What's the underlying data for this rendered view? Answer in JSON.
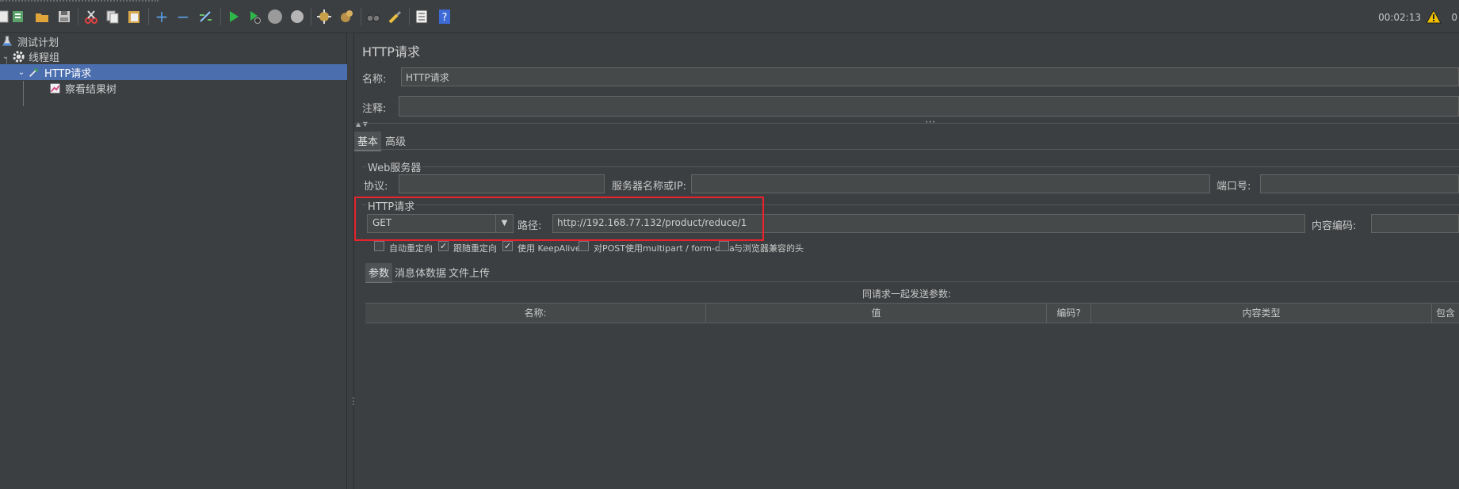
{
  "toolbar": {
    "icons": [
      "new-icon",
      "templates-icon",
      "open-icon",
      "save-icon",
      "cut-icon",
      "copy-icon",
      "paste-icon",
      "expand-icon",
      "collapse-icon",
      "toggle-icon",
      "start-icon",
      "start-no-pause-icon",
      "stop-icon",
      "shutdown-icon",
      "clear-icon",
      "clear-all-icon",
      "search-icon",
      "reset-search-icon",
      "function-helper-icon",
      "help-icon"
    ],
    "timer": "00:02:13",
    "warning_count": "0"
  },
  "tree": {
    "items": [
      {
        "label": "测试计划",
        "icon": "test-plan-icon"
      },
      {
        "label": "线程组",
        "icon": "thread-group-gear-icon"
      },
      {
        "label": "HTTP请求",
        "icon": "http-sampler-pipette-icon"
      },
      {
        "label": "察看结果树",
        "icon": "results-tree-chart-icon"
      }
    ]
  },
  "main": {
    "title": "HTTP请求",
    "name_label": "名称:",
    "name_value": "HTTP请求",
    "comment_label": "注释:",
    "comment_value": "",
    "tabs": [
      {
        "label": "基本"
      },
      {
        "label": "高级"
      }
    ],
    "web_server": {
      "title": "Web服务器",
      "protocol_label": "协议:",
      "protocol_value": "",
      "server_label": "服务器名称或IP:",
      "server_value": "",
      "port_label": "端口号:",
      "port_value": ""
    },
    "http_request": {
      "title": "HTTP请求",
      "method": "GET",
      "path_label": "路径:",
      "path_value": "http://192.168.77.132/product/reduce/1",
      "encoding_label": "内容编码:",
      "encoding_value": ""
    },
    "options": [
      {
        "label": "自动重定向",
        "checked": false
      },
      {
        "label": "跟随重定向",
        "checked": true
      },
      {
        "label": "使用 KeepAlive",
        "checked": true
      },
      {
        "label": "对POST使用multipart / form-data",
        "checked": false
      },
      {
        "label": "与浏览器兼容的头",
        "checked": false
      }
    ],
    "subtabs": [
      {
        "label": "参数"
      },
      {
        "label": "消息体数据"
      },
      {
        "label": "文件上传"
      }
    ],
    "params_caption": "同请求一起发送参数:",
    "columns": [
      "名称:",
      "值",
      "编码?",
      "内容类型",
      "包含"
    ]
  },
  "colors": {
    "background": "#3c3f41",
    "selection": "#4b6eaf",
    "highlight_box": "#e8232d"
  }
}
